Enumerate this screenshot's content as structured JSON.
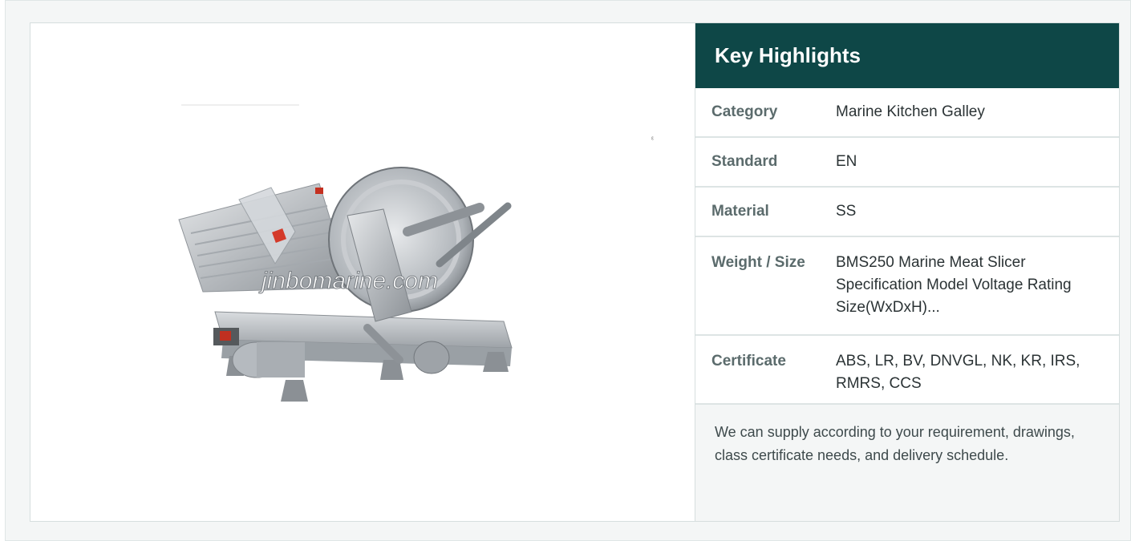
{
  "image": {
    "alt": "BMS250 Marine Meat Slicer",
    "watermark": "jinbomarine.com"
  },
  "highlights": {
    "title": "Key Highlights",
    "rows": [
      {
        "label": "Category",
        "value": "Marine Kitchen Galley"
      },
      {
        "label": "Standard",
        "value": "EN"
      },
      {
        "label": "Material",
        "value": "SS"
      },
      {
        "label": "Weight / Size",
        "value": "BMS250 Marine Meat Slicer Specification Model Voltage Rating Size(WxDxH)..."
      },
      {
        "label": "Certificate",
        "value": "ABS, LR, BV, DNVGL, NK, KR, IRS, RMRS, CCS"
      }
    ],
    "note": "We can supply according to your requirement, drawings, class certificate needs, and delivery schedule."
  },
  "colors": {
    "header_bg": "#0e4747",
    "label_text": "#5b6b6c",
    "value_text": "#2b3335",
    "note_bg": "#f4f6f6"
  }
}
